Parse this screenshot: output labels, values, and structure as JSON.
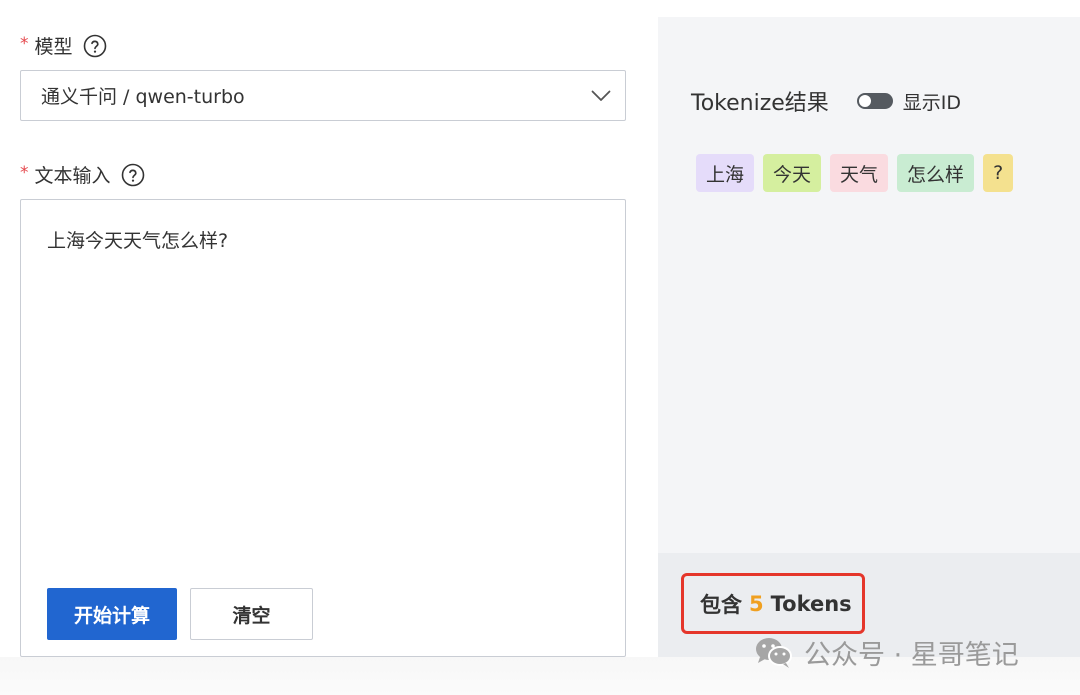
{
  "form": {
    "model_label": "模型",
    "required_mark": "*",
    "model_value": "通义千问 / qwen-turbo",
    "text_label": "文本输入",
    "text_value": "上海今天天气怎么样?",
    "start_button": "开始计算",
    "clear_button": "清空"
  },
  "result": {
    "title": "Tokenize结果",
    "toggle_label": "显示ID",
    "tokens": [
      {
        "text": "上海",
        "color": "#e5dcfa"
      },
      {
        "text": "今天",
        "color": "#d5ef9f"
      },
      {
        "text": "天气",
        "color": "#fadbe0"
      },
      {
        "text": "怎么样",
        "color": "#c9ecd2"
      },
      {
        "text": "?",
        "color": "#f4e18f"
      }
    ],
    "count_prefix": "包含",
    "count_value": "5",
    "count_suffix": "Tokens"
  },
  "watermark": {
    "text": "公众号 · 星哥笔记"
  },
  "colors": {
    "primary": "#2166d0",
    "highlight_border": "#e5362b",
    "count_number": "#f0a020"
  }
}
